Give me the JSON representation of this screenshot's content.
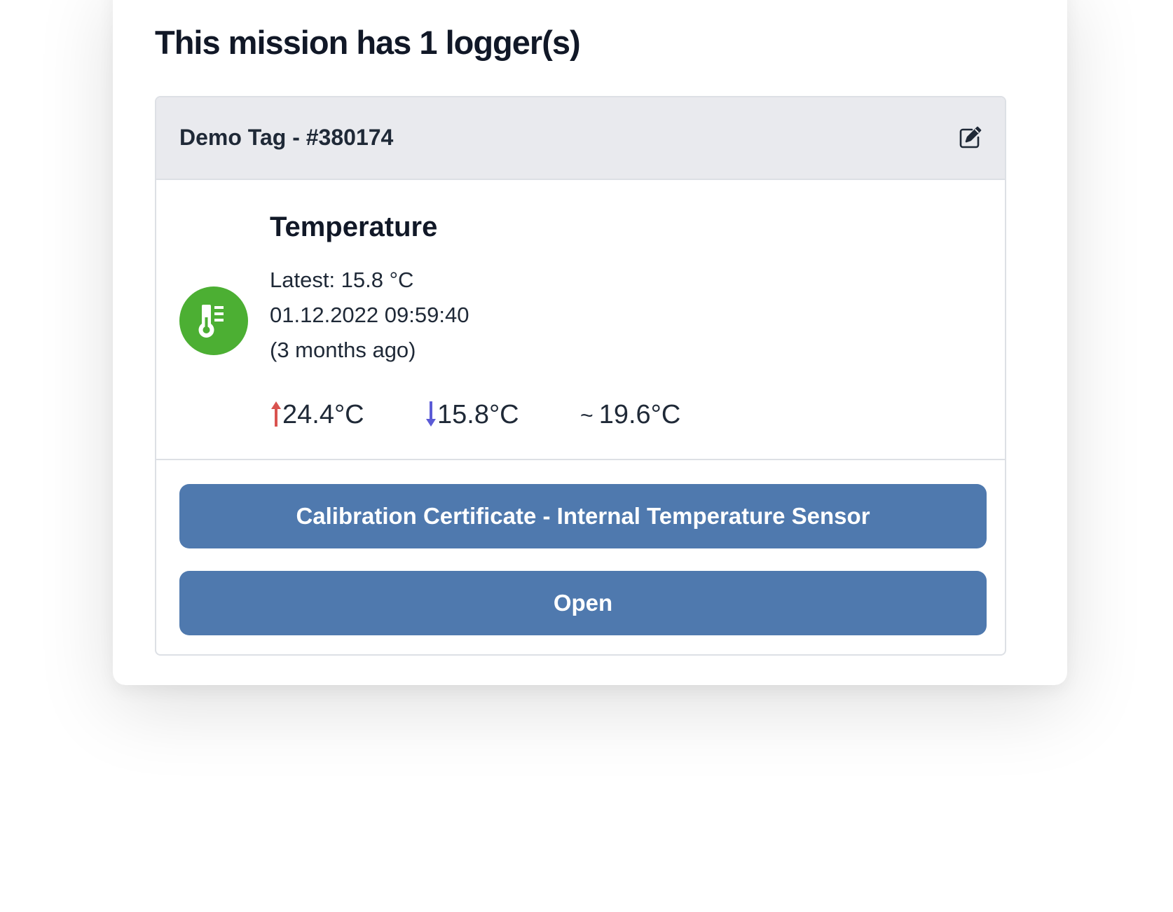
{
  "page": {
    "title": "This mission has 1 logger(s)"
  },
  "logger": {
    "name": "Demo Tag - #380174",
    "edit_icon": "edit-icon",
    "sensor": {
      "icon": "thermometer-icon",
      "icon_color": "#4caf33",
      "name": "Temperature",
      "latest": "Latest: 15.8 °C",
      "timestamp": "01.12.2022 09:59:40",
      "relative": "(3 months ago)",
      "max": "24.4°C",
      "max_icon": "arrow-up-icon",
      "max_color": "#d9534f",
      "min": "15.8°C",
      "min_icon": "arrow-down-icon",
      "min_color": "#5b5bd6",
      "avg_symbol": "~",
      "avg": "19.6°C"
    },
    "buttons": {
      "certificate_label": "Calibration Certificate - Internal Temperature Sensor",
      "open_label": "Open",
      "color": "#4f79ae"
    }
  }
}
